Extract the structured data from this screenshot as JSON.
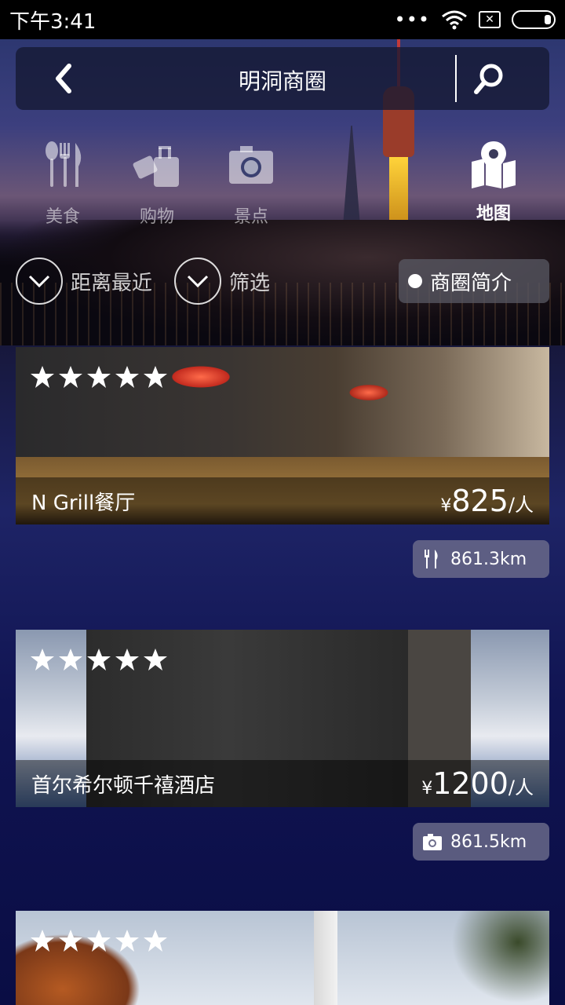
{
  "status_bar": {
    "time": "下午3:41"
  },
  "header": {
    "title": "明洞商圈"
  },
  "categories": [
    {
      "label": "美食",
      "icon": "fork-knife-icon",
      "active": false
    },
    {
      "label": "购物",
      "icon": "shopping-bag-icon",
      "active": false
    },
    {
      "label": "景点",
      "icon": "camera-icon",
      "active": false
    },
    {
      "label": "地图",
      "icon": "map-pin-icon",
      "active": true
    }
  ],
  "filters": {
    "sort_label": "距离最近",
    "filter_label": "筛选",
    "intro_label": "商圈简介"
  },
  "listings": [
    {
      "name": "N Grill餐厅",
      "currency": "¥",
      "price": "825",
      "unit": "/人",
      "rating": 5,
      "distance": "861.3km",
      "distance_icon": "fork-knife-icon"
    },
    {
      "name": "首尔希尔顿千禧酒店",
      "currency": "¥",
      "price": "1200",
      "unit": "/人",
      "rating": 5,
      "distance": "861.5km",
      "distance_icon": "camera-icon"
    },
    {
      "rating": 5
    }
  ],
  "colors": {
    "star": "#ffffff",
    "overlay": "#141832"
  }
}
